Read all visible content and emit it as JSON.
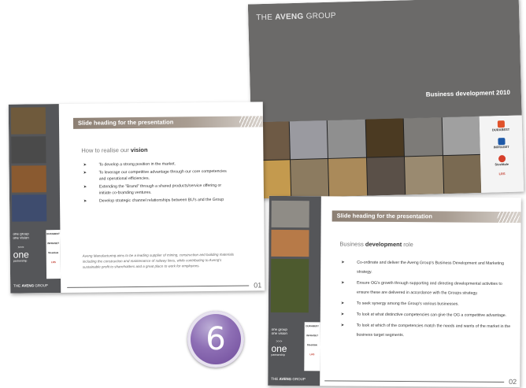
{
  "cover": {
    "logo_prefix": "THE ",
    "logo_brand": "AVENG",
    "logo_suffix": " GROUP",
    "title": "Business development 2010"
  },
  "brands": [
    "DURABEST",
    "INFRASET",
    "Steeldale",
    "LRS"
  ],
  "slide1": {
    "heading": "Slide heading for the presentation",
    "sub_prefix": "How to realise our ",
    "sub_bold": "vision",
    "bullets": [
      "To develop a strong position in the market.",
      "To leverage our competitive advantage through our core competencies and operational efficiencies.",
      "Extending the \"Brand\" through a shared products/service offering or initiate co-branding ventures.",
      "Develop strategic channel relationships between BU's and the Group"
    ],
    "quote": "Aveng Manufacturing aims to be a leading supplier of mining, construction and building materials including the construction and maintenance of railway lines, while contributing to Aveng's sustainable profit to shareholders and a great place to work for employees.",
    "number": "01",
    "side_line1": "one group",
    "side_line2": "one vision",
    "side_arrows": ">>>",
    "side_big": "one",
    "side_small": "partnership",
    "footer_prefix": "THE ",
    "footer_brand": "AVENG",
    "footer_suffix": " GROUP"
  },
  "slide2": {
    "heading": "Slide heading for the presentation",
    "sub_prefix": "Business ",
    "sub_bold": "development",
    "sub_suffix": " role",
    "bullets": [
      "Co-ordinate and deliver the Aveng Group's Business Development and Marketing strategy.",
      "Ensure OG's growth through supporting and directing developmental activities to ensure these are delivered in accordance with the Groups strategy.",
      "To seek synergy among the Group's various businesses.",
      "To look at what distinctive competencies can give the OG a competitive advantage.",
      "To look at which of the competencies match the needs and wants of the market in the business target segments."
    ],
    "number": "02",
    "side_line1": "one group",
    "side_line2": "one vision",
    "side_arrows": ">>>",
    "side_big": "one",
    "side_small": "partnership",
    "footer_prefix": "THE ",
    "footer_brand": "AVENG",
    "footer_suffix": " GROUP"
  },
  "badge": {
    "number": "6"
  },
  "colors": {
    "header": "#a89c91",
    "sidebar": "#555659",
    "cover": "#6b6a69",
    "badge": "#7b57a8"
  }
}
